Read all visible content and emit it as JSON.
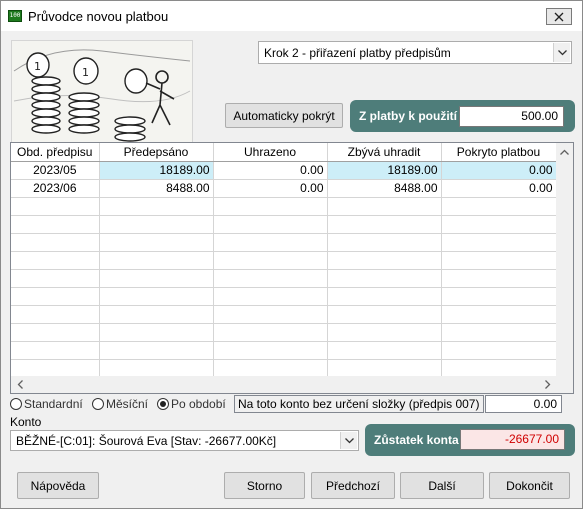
{
  "window": {
    "title": "Průvodce novou platbou",
    "app_icon_text": "100"
  },
  "step_select": {
    "value": "Krok 2 - přiřazení platby předpisům"
  },
  "auto_cover_button": {
    "label": "Automaticky pokrýt"
  },
  "payment_panel": {
    "label": "Z platby k použití",
    "value": "500.00"
  },
  "grid": {
    "columns": [
      "Obd. předpisu",
      "Předepsáno",
      "Uhrazeno",
      "Zbývá uhradit",
      "Pokryto platbou"
    ],
    "rows": [
      [
        "2023/05",
        "18189.00",
        "0.00",
        "18189.00",
        "0.00"
      ],
      [
        "2023/06",
        "8488.00",
        "0.00",
        "8488.00",
        "0.00"
      ]
    ],
    "empty_rows": 14
  },
  "mode": {
    "options": [
      "Standardní",
      "Měsíční",
      "Po období"
    ],
    "selected": "Po období"
  },
  "note": {
    "text": "Na toto konto bez určení složky (předpis 007)",
    "value": "0.00"
  },
  "konto": {
    "label": "Konto",
    "value": "BĚŽNÉ-[C:01]: Šourová Eva [Stav: -26677.00Kč]"
  },
  "balance_panel": {
    "label": "Zůstatek konta",
    "value": "-26677.00"
  },
  "buttons": {
    "help": "Nápověda",
    "cancel": "Storno",
    "previous": "Předchozí",
    "next": "Další",
    "finish": "Dokončit"
  },
  "colors": {
    "panel": "#4e7d7a",
    "row_highlight": "#cdeef8",
    "negative_value": "#d00000"
  }
}
